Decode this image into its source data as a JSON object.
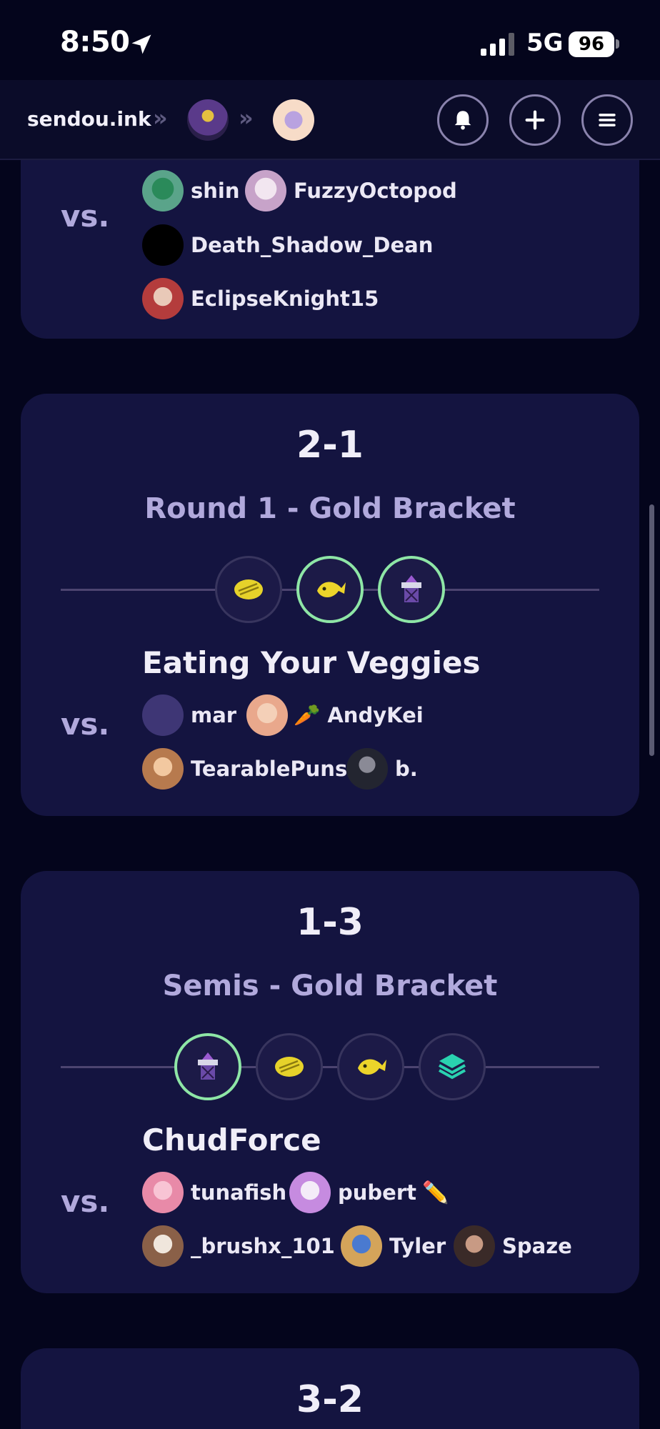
{
  "status": {
    "time": "8:50",
    "network": "5G",
    "battery": "96"
  },
  "header": {
    "site_name": "sendou.ink",
    "breadcrumb_sep": "»",
    "buttons": [
      "bell-icon",
      "plus-icon",
      "menu-icon"
    ]
  },
  "matches": [
    {
      "score": "",
      "round": "",
      "team": "",
      "vs": "vs.",
      "players": [
        {
          "name": "shin",
          "color": "#5aa48a"
        },
        {
          "name": "FuzzyOctopod",
          "color": "#c7a3c9"
        },
        {
          "name": "Death_Shadow_Dean",
          "color": "#000000"
        },
        {
          "name": "EclipseKnight15",
          "color": "#b43c3c"
        }
      ]
    },
    {
      "score": "2-1",
      "round": "Round 1 - Gold Bracket",
      "team": "Eating Your Veggies",
      "vs": "vs.",
      "maps": [
        {
          "icon": "coin-icon",
          "won": false
        },
        {
          "icon": "fish-icon",
          "won": true
        },
        {
          "icon": "tower-icon",
          "won": true
        }
      ],
      "players": [
        {
          "name": "mar",
          "emoji": "",
          "color": "#3e3675"
        },
        {
          "name": "AndyKei",
          "emoji": "🥕",
          "color": "#e9a88c"
        },
        {
          "name": "TearablePuns",
          "emoji": "",
          "color": "#b77a4e"
        },
        {
          "name": "b.",
          "emoji": "",
          "color": "#232530"
        }
      ]
    },
    {
      "score": "1-3",
      "round": "Semis - Gold Bracket",
      "team": "ChudForce",
      "vs": "vs.",
      "maps": [
        {
          "icon": "tower-icon",
          "won": true
        },
        {
          "icon": "coin-icon",
          "won": false
        },
        {
          "icon": "fish-icon",
          "won": false
        },
        {
          "icon": "rainmaker-icon",
          "won": false
        }
      ],
      "players": [
        {
          "name": "tunafish",
          "emoji": "",
          "color": "#e88aa8"
        },
        {
          "name": "pubert",
          "emoji": "✏️",
          "color": "#c68be0"
        },
        {
          "name": "_brushx_101",
          "emoji": "",
          "color": "#8a6048"
        },
        {
          "name": "Tyler",
          "emoji": "",
          "color": "#d4a45a"
        },
        {
          "name": "Spaze",
          "emoji": "",
          "color": "#3a2a28"
        }
      ]
    },
    {
      "score": "3-2"
    }
  ]
}
